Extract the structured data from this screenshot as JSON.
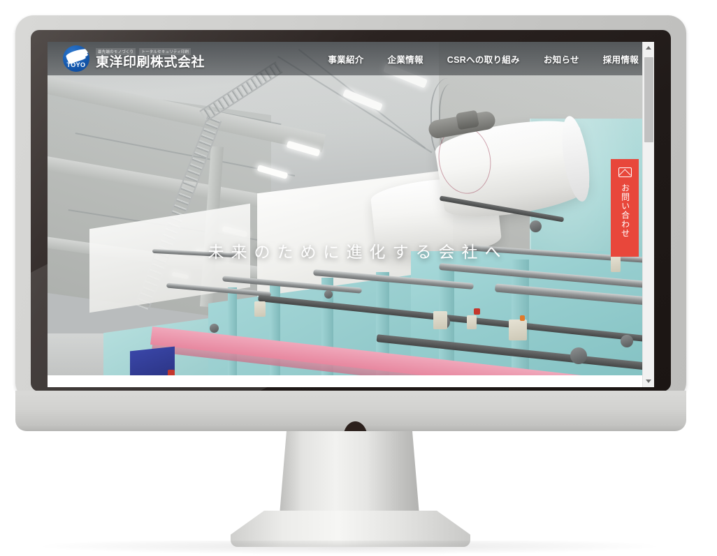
{
  "device": {
    "type": "desktop-monitor",
    "frame_color": "#cfcfcd",
    "bezel_color": "#241e1c",
    "chin_color": "#d2d2d0"
  },
  "site": {
    "brand": {
      "logo_text": "TOYO",
      "logo_color": "#1458ad",
      "tagline_1": "最先端のモノづくり",
      "tagline_2": "トータルセキュリティ印刷",
      "company_name": "東洋印刷株式会社"
    },
    "nav": {
      "items": [
        {
          "label": "事業紹介"
        },
        {
          "label": "企業情報"
        },
        {
          "label": "CSRへの取り組み"
        },
        {
          "label": "お知らせ"
        },
        {
          "label": "採用情報"
        }
      ]
    },
    "hero": {
      "headline": "未来のために進化する会社へ",
      "image_alt": "印刷工場の輪転機と紙ロール"
    },
    "contact_tab": {
      "label": "お問い合わせ",
      "icon": "envelope-icon",
      "background_color": "#e8473b",
      "text_color": "#ffffff"
    }
  },
  "browser": {
    "scrollbar": {
      "up_arrow": "▲",
      "down_arrow": "▼",
      "track_color": "#f1f1f1",
      "thumb_color": "#c1c1c1"
    }
  }
}
